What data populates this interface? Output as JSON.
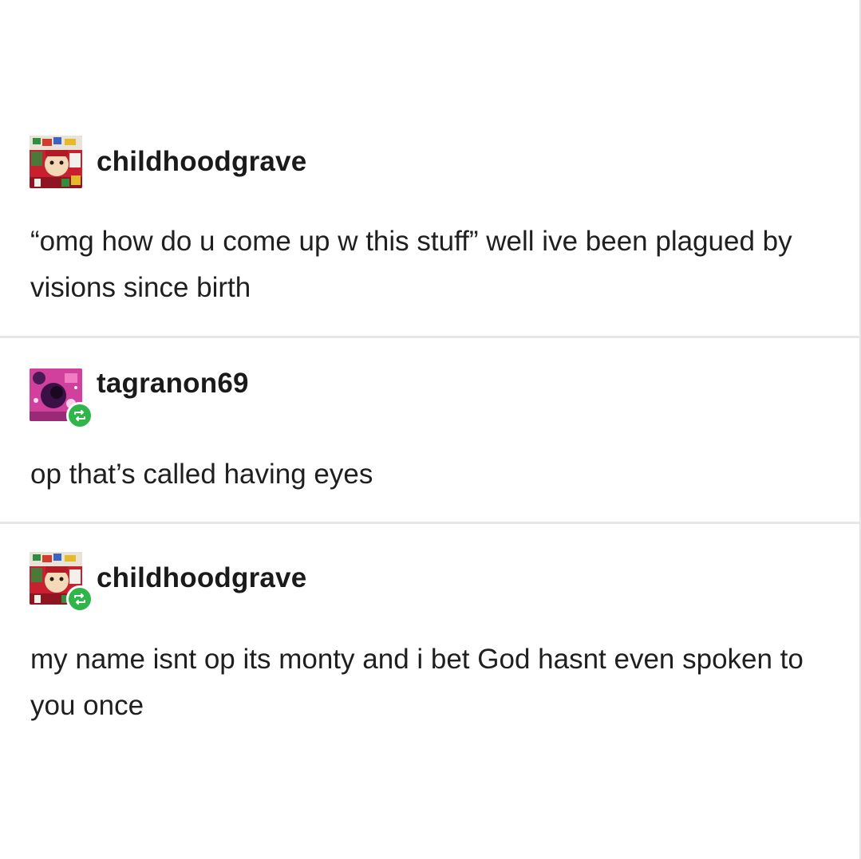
{
  "posts": [
    {
      "username": "childhoodgrave",
      "avatar_icon": "childhoodgrave-avatar",
      "reblogged": false,
      "text": "“omg how do u come up w this stuff” well ive been plagued by visions since birth"
    },
    {
      "username": "tagranon69",
      "avatar_icon": "tagranon69-avatar",
      "reblogged": true,
      "text": "op that’s called having eyes"
    },
    {
      "username": "childhoodgrave",
      "avatar_icon": "childhoodgrave-avatar",
      "reblogged": true,
      "text": "my name isnt op its monty and i bet God hasnt even spoken to you once"
    }
  ],
  "colors": {
    "reblog_badge": "#2fb54a",
    "divider": "#e6e6e6",
    "text": "#1f1f1f"
  }
}
